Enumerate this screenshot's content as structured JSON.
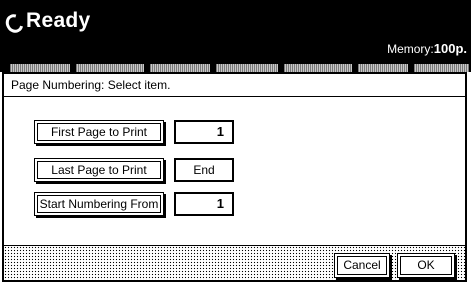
{
  "header": {
    "status_icon": "ready-circle-icon",
    "status_text": "Ready",
    "memory_label": "Memory:",
    "memory_value": "100p."
  },
  "dialog": {
    "title": "Page Numbering: Select item.",
    "rows": [
      {
        "label": "First Page to Print",
        "value": "1"
      },
      {
        "label": "Last Page to Print",
        "value": "End"
      },
      {
        "label": "Start Numbering From",
        "value": "1"
      }
    ],
    "cancel_label": "Cancel",
    "ok_label": "OK"
  }
}
